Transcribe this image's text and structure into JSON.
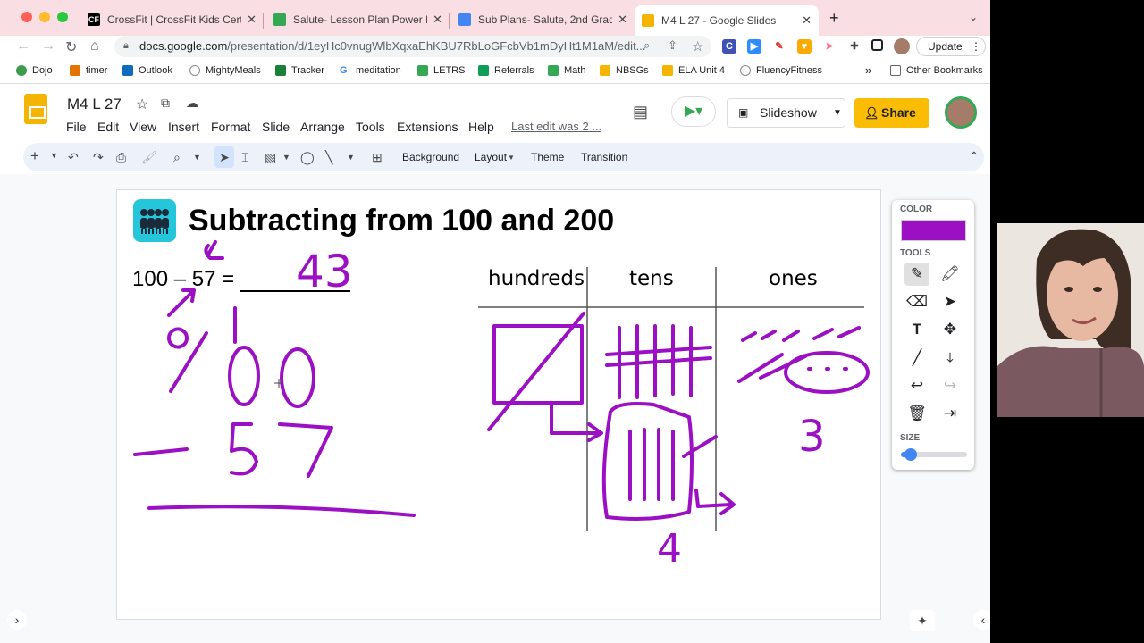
{
  "browser": {
    "tabs": [
      {
        "title": "CrossFit | CrossFit Kids Certific...",
        "favicon": "CF",
        "color": "#000000"
      },
      {
        "title": "Salute- Lesson Plan Power Poi...",
        "favicon": "drive-icon",
        "color": "#34a853"
      },
      {
        "title": "Sub Plans- Salute, 2nd Grade 2...",
        "favicon": "docs-icon",
        "color": "#4285f4"
      },
      {
        "title": "M4 L 27 - Google Slides",
        "favicon": "slides-icon",
        "color": "#f4b400"
      }
    ],
    "new_tab_symbol": "+",
    "url_host": "docs.google.com",
    "url_path": "/presentation/d/1eyHc0vnugWlbXqxaEhKBU7RbLoGFcbVb1mDyHt1M1aM/edit...",
    "update_label": "Update",
    "bookmarks": [
      "Dojo",
      "timer",
      "Outlook",
      "MightyMeals",
      "Tracker",
      "meditation",
      "LETRS",
      "Referrals",
      "Math",
      "NBSGs",
      "ELA Unit 4",
      "FluencyFitness"
    ],
    "bookmarks_overflow": "»",
    "other_bookmarks": "Other Bookmarks"
  },
  "slides_app": {
    "doc_title": "M4 L 27",
    "menu": [
      "File",
      "Edit",
      "View",
      "Insert",
      "Format",
      "Slide",
      "Arrange",
      "Tools",
      "Extensions",
      "Help"
    ],
    "last_edit": "Last edit was 2 ...",
    "slideshow_label": "Slideshow",
    "share_label": "Share",
    "toolbar_text": {
      "background": "Background",
      "layout": "Layout",
      "theme": "Theme",
      "transition": "Transition"
    }
  },
  "slide": {
    "title": "Subtracting from 100 and 200",
    "equation": "100 – 57 =",
    "handwritten_answer": "43",
    "columns": [
      "hundreds",
      "tens",
      "ones"
    ],
    "handwritten_work": {
      "top": "100",
      "minus": "57",
      "tens_result": "4",
      "ones_result": "3"
    }
  },
  "annotation_panel": {
    "color_label": "COLOR",
    "tools_label": "TOOLS",
    "size_label": "SIZE",
    "pen_color": "#9c10c4",
    "size_level": 0.1
  }
}
